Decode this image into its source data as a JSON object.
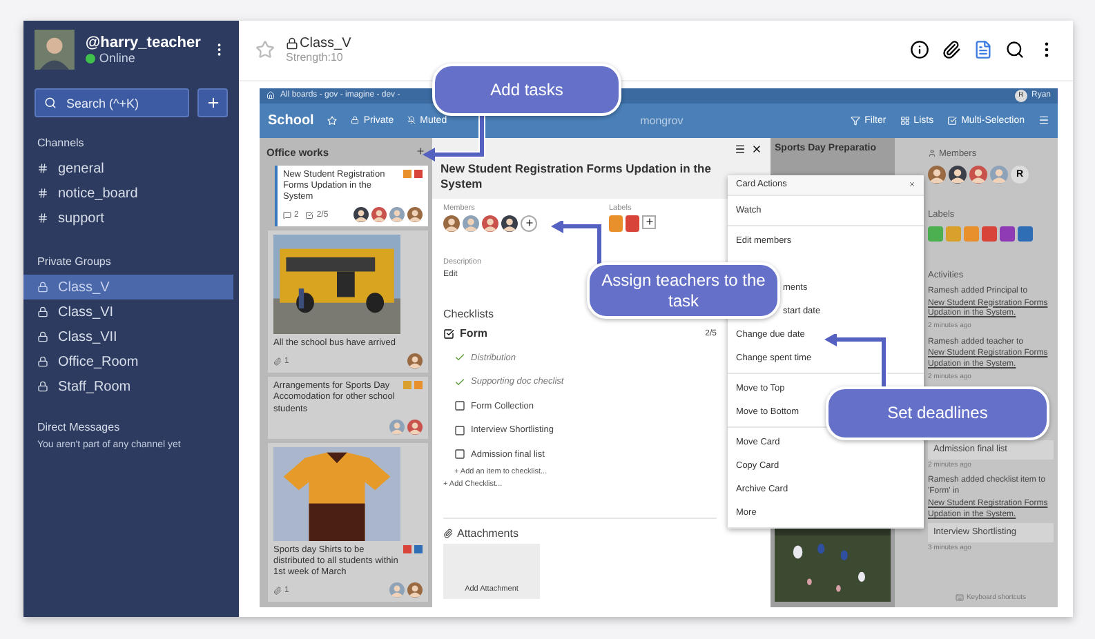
{
  "sidebar": {
    "user": {
      "name": "@harry_teacher",
      "status": "Online",
      "online": true
    },
    "search": {
      "placeholder": "Search (^+K)"
    },
    "channels": {
      "title": "Channels",
      "items": [
        {
          "label": "general",
          "selected": false
        },
        {
          "label": "notice_board",
          "selected": false
        },
        {
          "label": "support",
          "selected": false
        }
      ]
    },
    "groups": {
      "title": "Private Groups",
      "items": [
        {
          "label": "Class_V",
          "selected": true
        },
        {
          "label": "Class_VI",
          "selected": false
        },
        {
          "label": "Class_VII",
          "selected": false
        },
        {
          "label": "Office_Room",
          "selected": false
        },
        {
          "label": "Staff_Room",
          "selected": false
        }
      ]
    },
    "direct": {
      "title": "Direct Messages",
      "note": "You aren't part of any channel yet"
    }
  },
  "header": {
    "title": "Class_V",
    "subtitle": "Strength:10",
    "starred": false
  },
  "board": {
    "breadcrumb": "All boards - gov - imagine - dev -",
    "user": {
      "initial": "R",
      "name": "Ryan"
    },
    "title": "School",
    "private": "Private",
    "muted": "Muted",
    "org": "mongrov",
    "tools": [
      {
        "kind": "filter",
        "label": "Filter"
      },
      {
        "kind": "lists",
        "label": "Lists"
      },
      {
        "kind": "multi",
        "label": "Multi-Selection"
      }
    ],
    "list": {
      "title": "Office works",
      "cards": [
        {
          "kind": "text",
          "selected": true,
          "title": "New Student Registration Forms Updation in the System",
          "comments": "2",
          "checklist": "2/5",
          "labels": [
            {
              "color": "#e8912c"
            },
            {
              "color": "#d9443a"
            }
          ],
          "members": [
            {
              "color": "#3a3f4a"
            },
            {
              "color": "#c9524c"
            },
            {
              "color": "#8fa3b8"
            },
            {
              "color": "#9a6a42"
            }
          ]
        },
        {
          "kind": "picture",
          "selected": false,
          "title": "All the school bus have arrived",
          "attachments": "1",
          "members": [
            {
              "color": "#9a6a42"
            }
          ]
        },
        {
          "kind": "text",
          "selected": false,
          "title": "Arrangements for Sports Day Accomodation for other school students",
          "labels": [
            {
              "color": "#d9a12c"
            },
            {
              "color": "#e8912c"
            }
          ],
          "members": [
            {
              "color": "#8fa3b8"
            },
            {
              "color": "#c9524c"
            }
          ]
        },
        {
          "kind": "picture",
          "selected": false,
          "title": "Sports day Shirts to be distributed to all students within 1st week of March",
          "attachments": "1",
          "labels": [
            {
              "color": "#d9443a"
            },
            {
              "color": "#2f6db5"
            }
          ],
          "members": [
            {
              "color": "#8fa3b8"
            },
            {
              "color": "#9a6a42"
            }
          ]
        }
      ]
    },
    "detail": {
      "title": "New Student Registration Forms Updation in the System",
      "members_label": "Members",
      "members": [
        {
          "color": "#9a6a42"
        },
        {
          "color": "#8fa3b8"
        },
        {
          "color": "#c9524c"
        },
        {
          "color": "#3a3f4a"
        }
      ],
      "labels_label": "Labels",
      "labels": [
        {
          "color": "#e8912c"
        },
        {
          "color": "#d9443a"
        }
      ],
      "description_label": "Description",
      "description": "Edit",
      "checklists_title": "Checklists",
      "checklist": {
        "name": "Form",
        "checked": true,
        "progress": "2/5",
        "items": [
          {
            "label": "Distribution",
            "checked": true
          },
          {
            "label": "Supporting doc checlist",
            "checked": true
          },
          {
            "label": "Form Collection",
            "checked": false
          },
          {
            "label": "Interview Shortlisting",
            "checked": false
          },
          {
            "label": "Admission final list",
            "checked": false
          }
        ]
      },
      "add_item": "+ Add an item to checklist...",
      "add_checklist": "+ Add Checklist...",
      "attachments_title": "Attachments",
      "add_attachment": "Add Attachment"
    },
    "column": {
      "title": "Sports Day Preparatio"
    },
    "menu": {
      "title": "Card Actions",
      "groups": [
        [
          {
            "label": "Watch",
            "kind": "plain"
          }
        ],
        [
          {
            "label": "Edit members",
            "kind": "plain"
          },
          {
            "label": "ments",
            "kind": "covered"
          },
          {
            "label": "start date",
            "kind": "covered"
          },
          {
            "label": "Change due date",
            "kind": "plain"
          },
          {
            "label": "Change spent time",
            "kind": "plain"
          }
        ],
        [
          {
            "label": "Move to Top",
            "kind": "plain"
          },
          {
            "label": "Move to Bottom",
            "kind": "plain"
          }
        ],
        [
          {
            "label": "Move Card",
            "kind": "plain"
          },
          {
            "label": "Copy Card",
            "kind": "plain"
          },
          {
            "label": "Archive Card",
            "kind": "plain"
          },
          {
            "label": "More",
            "kind": "plain"
          }
        ]
      ]
    },
    "panel": {
      "members_label": "Members",
      "members": [
        {
          "color": "#9a6a42"
        },
        {
          "color": "#3a3f4a"
        },
        {
          "color": "#c9524c"
        },
        {
          "color": "#8fa3b8"
        }
      ],
      "member_initial": "R",
      "labels_label": "Labels",
      "labels": [
        {
          "color": "#4caf50"
        },
        {
          "color": "#d9a12c"
        },
        {
          "color": "#e8912c"
        },
        {
          "color": "#d9443a"
        },
        {
          "color": "#8e3bb5"
        },
        {
          "color": "#2f6db5"
        }
      ],
      "activities_label": "Activities",
      "activities": [
        {
          "text": "Ramesh added Principal to",
          "link": "New Student Registration Forms Updation in the System.",
          "time": "2 minutes ago"
        },
        {
          "text": "Ramesh added teacher to",
          "link": "New Student Registration Forms Updation in the System.",
          "time": "2 minutes ago"
        },
        {
          "quote": "Admission final list",
          "time": "2 minutes ago"
        },
        {
          "text": "Ramesh added checklist item to 'Form' in",
          "link": "New Student Registration Forms Updation in the System.",
          "quote": "Interview Shortlisting",
          "time": "3 minutes ago"
        }
      ],
      "footer": "Keyboard shortcuts"
    }
  },
  "callouts": [
    {
      "label": "Add tasks"
    },
    {
      "label": "Assign teachers to the task"
    },
    {
      "label": "Set deadlines"
    }
  ]
}
